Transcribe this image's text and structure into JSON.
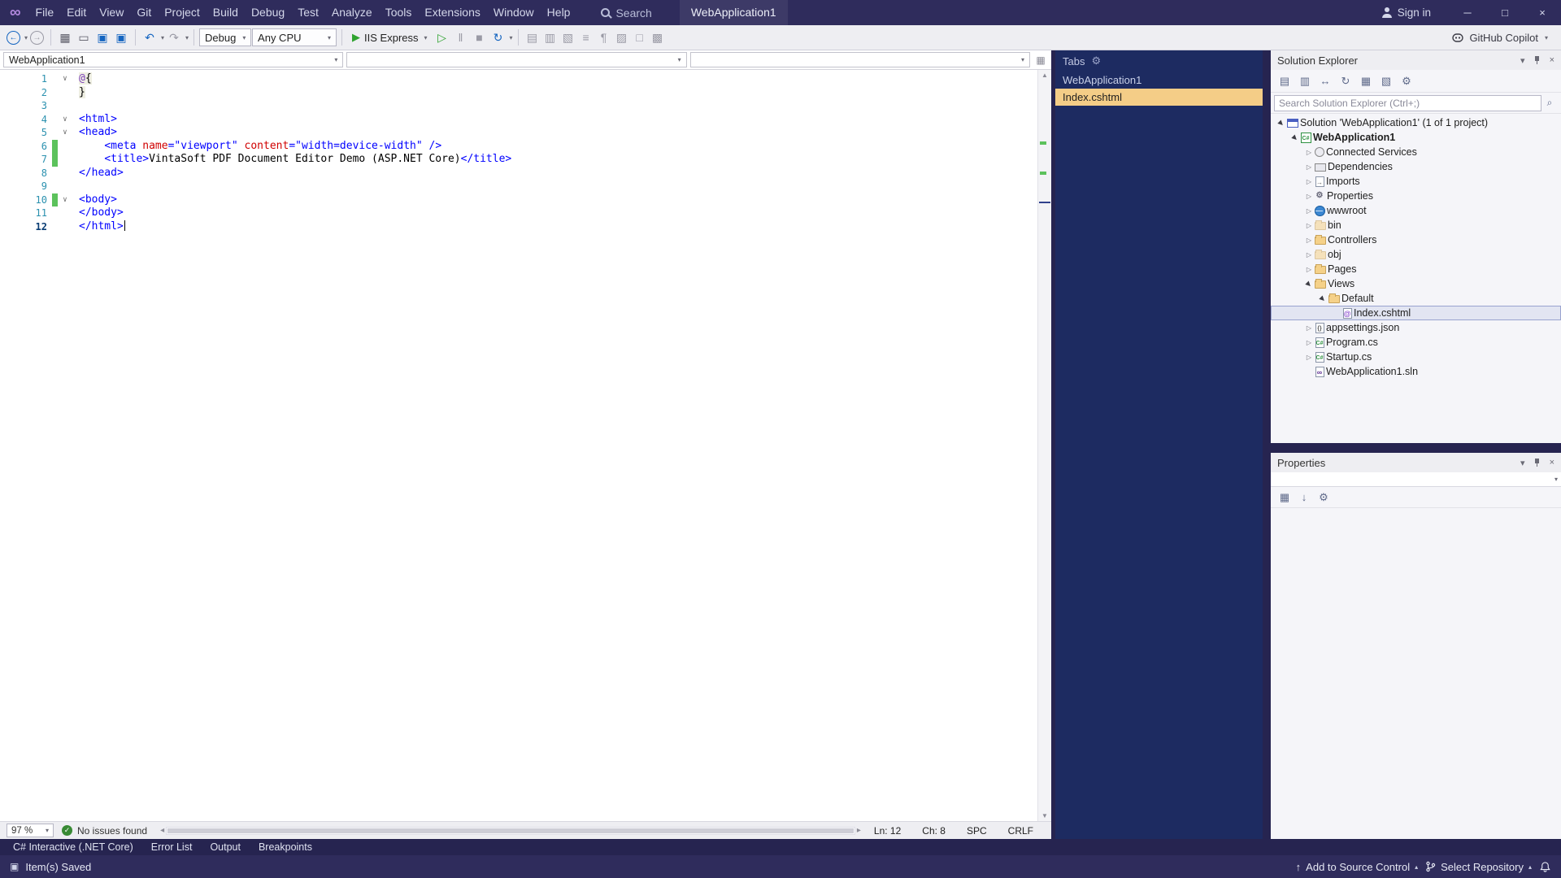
{
  "theme": {
    "titlebar_bg": "#2f2c5c",
    "statusbar_bg": "#2f2c5c",
    "window_bg": "#262450",
    "toolbar_bg": "#eeeef2",
    "tabs_panel_bg": "#1d2b61",
    "selection_tan": "#f4cd87",
    "change_green": "#5cc25c",
    "line_number": "#2b91af",
    "tag_color": "#0000ff",
    "attr_color": "#d00000",
    "value_color": "#0000ff",
    "panel_bg": "#f5f5f9"
  },
  "icons": {
    "back": "←",
    "forward": "→",
    "caret": "▾",
    "caret_up": "▴",
    "new_project": "▦",
    "open_file": "▭",
    "save": "▣",
    "save_all": "▣",
    "undo": "↶",
    "redo": "↷",
    "play": "▶",
    "play_outline": "▷",
    "pause": "‖",
    "stop": "■",
    "refresh": "↻",
    "gear": "⚙",
    "check": "✓",
    "split": "▦",
    "publish": "↑",
    "saved_doc": "▣",
    "hscroll_left": "◂",
    "hscroll_right": "▸",
    "editor_icons": [
      "▤",
      "▥",
      "▧",
      "≡",
      "¶",
      "▨",
      "□",
      "▩"
    ]
  },
  "titlebar": {
    "menus": [
      "File",
      "Edit",
      "View",
      "Git",
      "Project",
      "Build",
      "Debug",
      "Test",
      "Analyze",
      "Tools",
      "Extensions",
      "Window",
      "Help"
    ],
    "search_label": "Search",
    "window_title": "WebApplication1",
    "sign_in_label": "Sign in",
    "minimize": "─",
    "maximize": "□",
    "close": "×"
  },
  "toolbar": {
    "debug_target": "Debug",
    "platform": "Any CPU",
    "run_label": "IIS Express",
    "copilot_label": "GitHub Copilot"
  },
  "editor": {
    "breadcrumbs": {
      "project": "WebApplication1"
    },
    "lines": [
      {
        "n": 1,
        "fold": true,
        "razor": true,
        "tokens": [
          [
            "@",
            "razor-at"
          ],
          [
            "{",
            "razor-brace"
          ]
        ]
      },
      {
        "n": 2,
        "razor": true,
        "tokens": [
          [
            "}",
            "razor-brace"
          ]
        ]
      },
      {
        "n": 3,
        "tokens": []
      },
      {
        "n": 4,
        "fold": true,
        "tokens": [
          [
            "<html>",
            "tag"
          ]
        ]
      },
      {
        "n": 5,
        "fold": true,
        "tokens": [
          [
            "<head>",
            "tag"
          ]
        ]
      },
      {
        "n": 6,
        "changed": true,
        "tokens": [
          [
            "    ",
            "plain"
          ],
          [
            "<meta ",
            "tag"
          ],
          [
            "name",
            "attr"
          ],
          [
            "=\"viewport\"",
            "val"
          ],
          [
            " ",
            "plain"
          ],
          [
            "content",
            "attr"
          ],
          [
            "=\"width=device-width\"",
            "val"
          ],
          [
            " />",
            "tag"
          ]
        ]
      },
      {
        "n": 7,
        "changed": true,
        "tokens": [
          [
            "    ",
            "plain"
          ],
          [
            "<title>",
            "tag"
          ],
          [
            "VintaSoft PDF Document Editor Demo (ASP.NET Core)",
            "plain"
          ],
          [
            "</title>",
            "tag"
          ]
        ]
      },
      {
        "n": 8,
        "tokens": [
          [
            "</head>",
            "tag"
          ]
        ]
      },
      {
        "n": 9,
        "tokens": []
      },
      {
        "n": 10,
        "fold": true,
        "changed": true,
        "tokens": [
          [
            "<body>",
            "tag"
          ]
        ]
      },
      {
        "n": 11,
        "tokens": [
          [
            "</body>",
            "tag"
          ]
        ]
      },
      {
        "n": 12,
        "active": true,
        "caret": true,
        "tokens": [
          [
            "</html>",
            "tag"
          ]
        ]
      }
    ],
    "status": {
      "zoom": "97 %",
      "health": "No issues found",
      "ln": "Ln: 12",
      "ch": "Ch: 8",
      "encoding": "SPC",
      "line_ending": "CRLF"
    },
    "scroll_marks": [
      {
        "top_pct": 9.5,
        "color": "#5cc25c",
        "kind": "change"
      },
      {
        "top_pct": 13.5,
        "color": "#5cc25c",
        "kind": "change"
      },
      {
        "top_pct": 17.5,
        "color": "#30408c",
        "kind": "caret"
      }
    ]
  },
  "tabs_panel": {
    "title": "Tabs",
    "items": [
      {
        "label": "WebApplication1",
        "kind": "project",
        "selected": false
      },
      {
        "label": "Index.cshtml",
        "kind": "doc",
        "selected": true
      }
    ]
  },
  "solution_explorer": {
    "title": "Solution Explorer",
    "search_placeholder": "Search Solution Explorer (Ctrl+;)",
    "toolbar_icons": [
      {
        "name": "switch-views-icon",
        "glyph": "▤"
      },
      {
        "name": "pending-changes-filter-icon",
        "glyph": "▥"
      },
      {
        "name": "sync-with-active-document-icon",
        "glyph": "↔"
      },
      {
        "name": "refresh-icon",
        "glyph": "↻"
      },
      {
        "name": "collapse-all-icon",
        "glyph": "▦"
      },
      {
        "name": "show-all-files-icon",
        "glyph": "▧"
      },
      {
        "name": "properties-icon",
        "glyph": "⚙"
      }
    ],
    "tree": [
      {
        "label": "Solution 'WebApplication1' (1 of 1 project)",
        "level": 0,
        "arrow": "expanded",
        "icon": "solution"
      },
      {
        "label": "WebApplication1",
        "level": 1,
        "arrow": "expanded",
        "icon": "project",
        "bold": true
      },
      {
        "label": "Connected Services",
        "level": 2,
        "arrow": "collapsed",
        "icon": "services"
      },
      {
        "label": "Dependencies",
        "level": 2,
        "arrow": "collapsed",
        "icon": "deps"
      },
      {
        "label": "Imports",
        "level": 2,
        "arrow": "collapsed",
        "icon": "imports"
      },
      {
        "label": "Properties",
        "level": 2,
        "arrow": "collapsed",
        "icon": "props"
      },
      {
        "label": "wwwroot",
        "level": 2,
        "arrow": "collapsed",
        "icon": "globe"
      },
      {
        "label": "bin",
        "level": 2,
        "arrow": "collapsed",
        "icon": "folder-dim"
      },
      {
        "label": "Controllers",
        "level": 2,
        "arrow": "collapsed",
        "icon": "folder"
      },
      {
        "label": "obj",
        "level": 2,
        "arrow": "collapsed",
        "icon": "folder-dim"
      },
      {
        "label": "Pages",
        "level": 2,
        "arrow": "collapsed",
        "icon": "folder"
      },
      {
        "label": "Views",
        "level": 2,
        "arrow": "expanded",
        "icon": "folder-open"
      },
      {
        "label": "Default",
        "level": 3,
        "arrow": "expanded",
        "icon": "folder-open"
      },
      {
        "label": "Index.cshtml",
        "level": 4,
        "arrow": "none",
        "icon": "cshtml",
        "selected": true
      },
      {
        "label": "appsettings.json",
        "level": 2,
        "arrow": "collapsed",
        "icon": "json"
      },
      {
        "label": "Program.cs",
        "level": 2,
        "arrow": "collapsed",
        "icon": "cs"
      },
      {
        "label": "Startup.cs",
        "level": 2,
        "arrow": "collapsed",
        "icon": "cs"
      },
      {
        "label": "WebApplication1.sln",
        "level": 2,
        "arrow": "none",
        "icon": "sln"
      }
    ]
  },
  "properties_panel": {
    "title": "Properties",
    "toolbar_icons": [
      {
        "name": "categorized-icon",
        "glyph": "▦"
      },
      {
        "name": "alphabetical-icon",
        "glyph": "↓"
      },
      {
        "name": "property-pages-icon",
        "glyph": "⚙"
      }
    ]
  },
  "panel_tabs": [
    {
      "label": "C# Interactive (.NET Core)"
    },
    {
      "label": "Error List"
    },
    {
      "label": "Output"
    },
    {
      "label": "Breakpoints"
    }
  ],
  "statusbar": {
    "message": "Item(s) Saved",
    "add_to_source_control": "Add to Source Control",
    "select_repository": "Select Repository"
  }
}
